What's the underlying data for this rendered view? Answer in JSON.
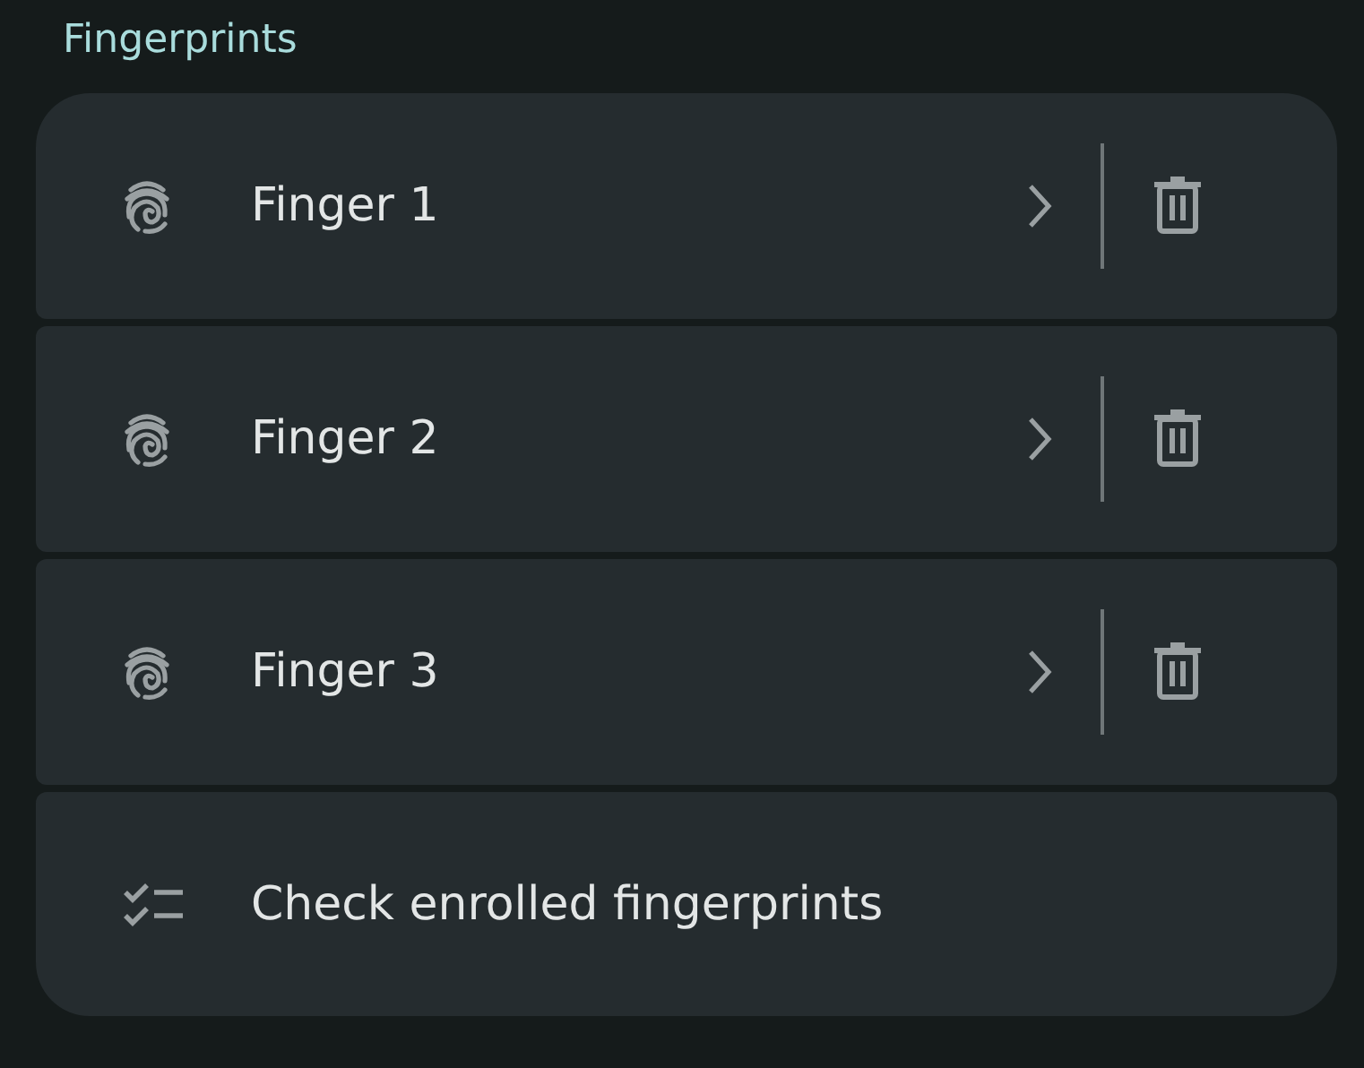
{
  "section_title": "Fingerprints",
  "items": [
    {
      "kind": "fingerprint",
      "label": "Finger 1"
    },
    {
      "kind": "fingerprint",
      "label": "Finger 2"
    },
    {
      "kind": "fingerprint",
      "label": "Finger 3"
    },
    {
      "kind": "action",
      "label": "Check enrolled fingerprints"
    }
  ]
}
